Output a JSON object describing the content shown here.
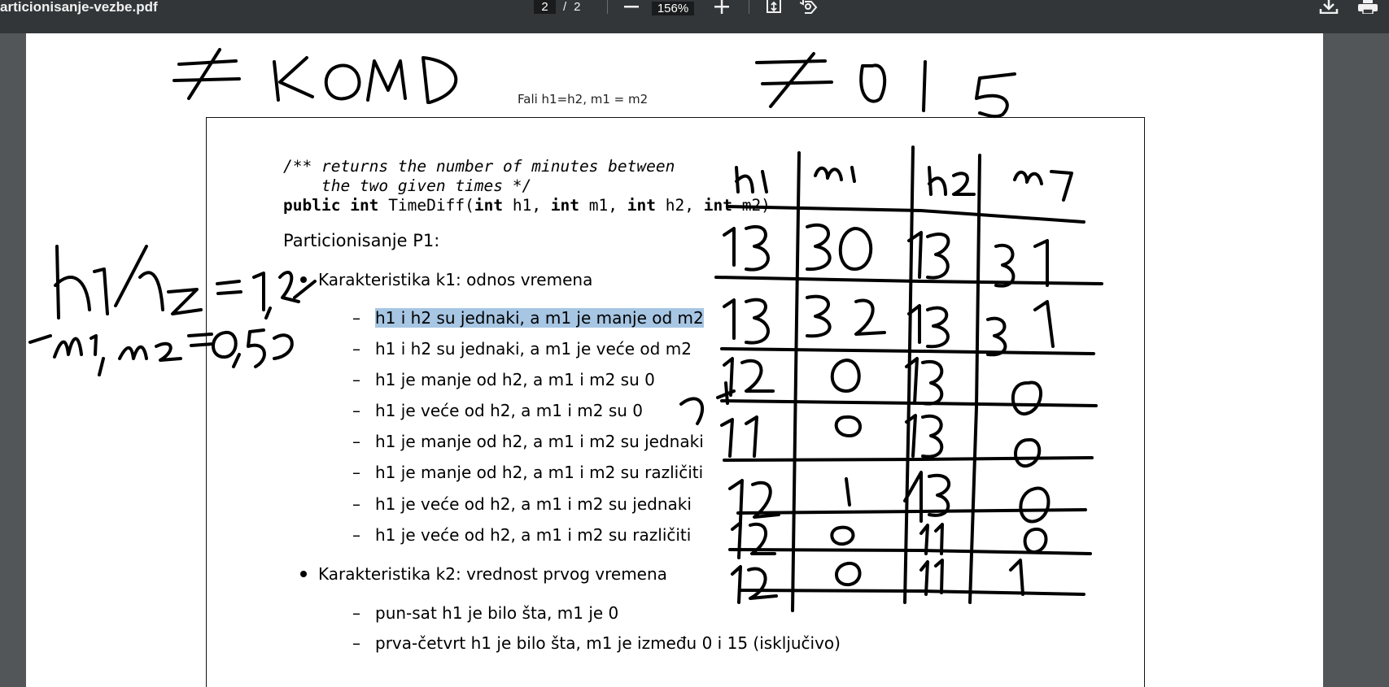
{
  "toolbar": {
    "doc_title": "articionisanje-vezbe.pdf",
    "page_current": "2",
    "page_sep": "/",
    "page_total": "2",
    "zoom": "156%"
  },
  "page": {
    "annotation_note": "Fali h1=h2, m1 = m2",
    "code": {
      "comment_line1": "/** returns the number of minutes between",
      "comment_line2": "    the two given times */",
      "kw_public": "public",
      "kw_int": "int",
      "fn_name": "TimeDiff(",
      "param_h1": "h1, ",
      "param_m1": "m1, ",
      "param_h2": "h2, ",
      "param_m2": "m2)"
    },
    "heading": "Particionisanje P1:",
    "k1": {
      "title": "Karakteristika k1: odnos vremena",
      "items": [
        "h1 i h2 su jednaki, a m1 je manje od m2",
        "h1 i h2 su jednaki, a m1 je veće od m2",
        "h1 je manje od h2, a m1 i m2 su 0",
        "h1 je veće od h2, a m1 i m2 su 0",
        "h1 je manje od h2, a m1 i m2 su jednaki",
        "h1 je manje od h2, a m1 i m2 su različiti",
        "h1 je veće od h2, a m1 i m2 su jednaki",
        "h1 je veće od h2, a m1 i m2 su različiti"
      ]
    },
    "k2": {
      "title": "Karakteristika k2: vrednost prvog vremena",
      "items": [
        "pun-sat h1 je bilo šta, m1 je 0",
        "prva-četvrt h1 je bilo šta, m1 je između 0 i 15 (isključivo)"
      ]
    }
  },
  "colors": {
    "toolbar_bg": "#323639",
    "viewer_bg": "#525659",
    "highlight": "#a7c6e3"
  }
}
